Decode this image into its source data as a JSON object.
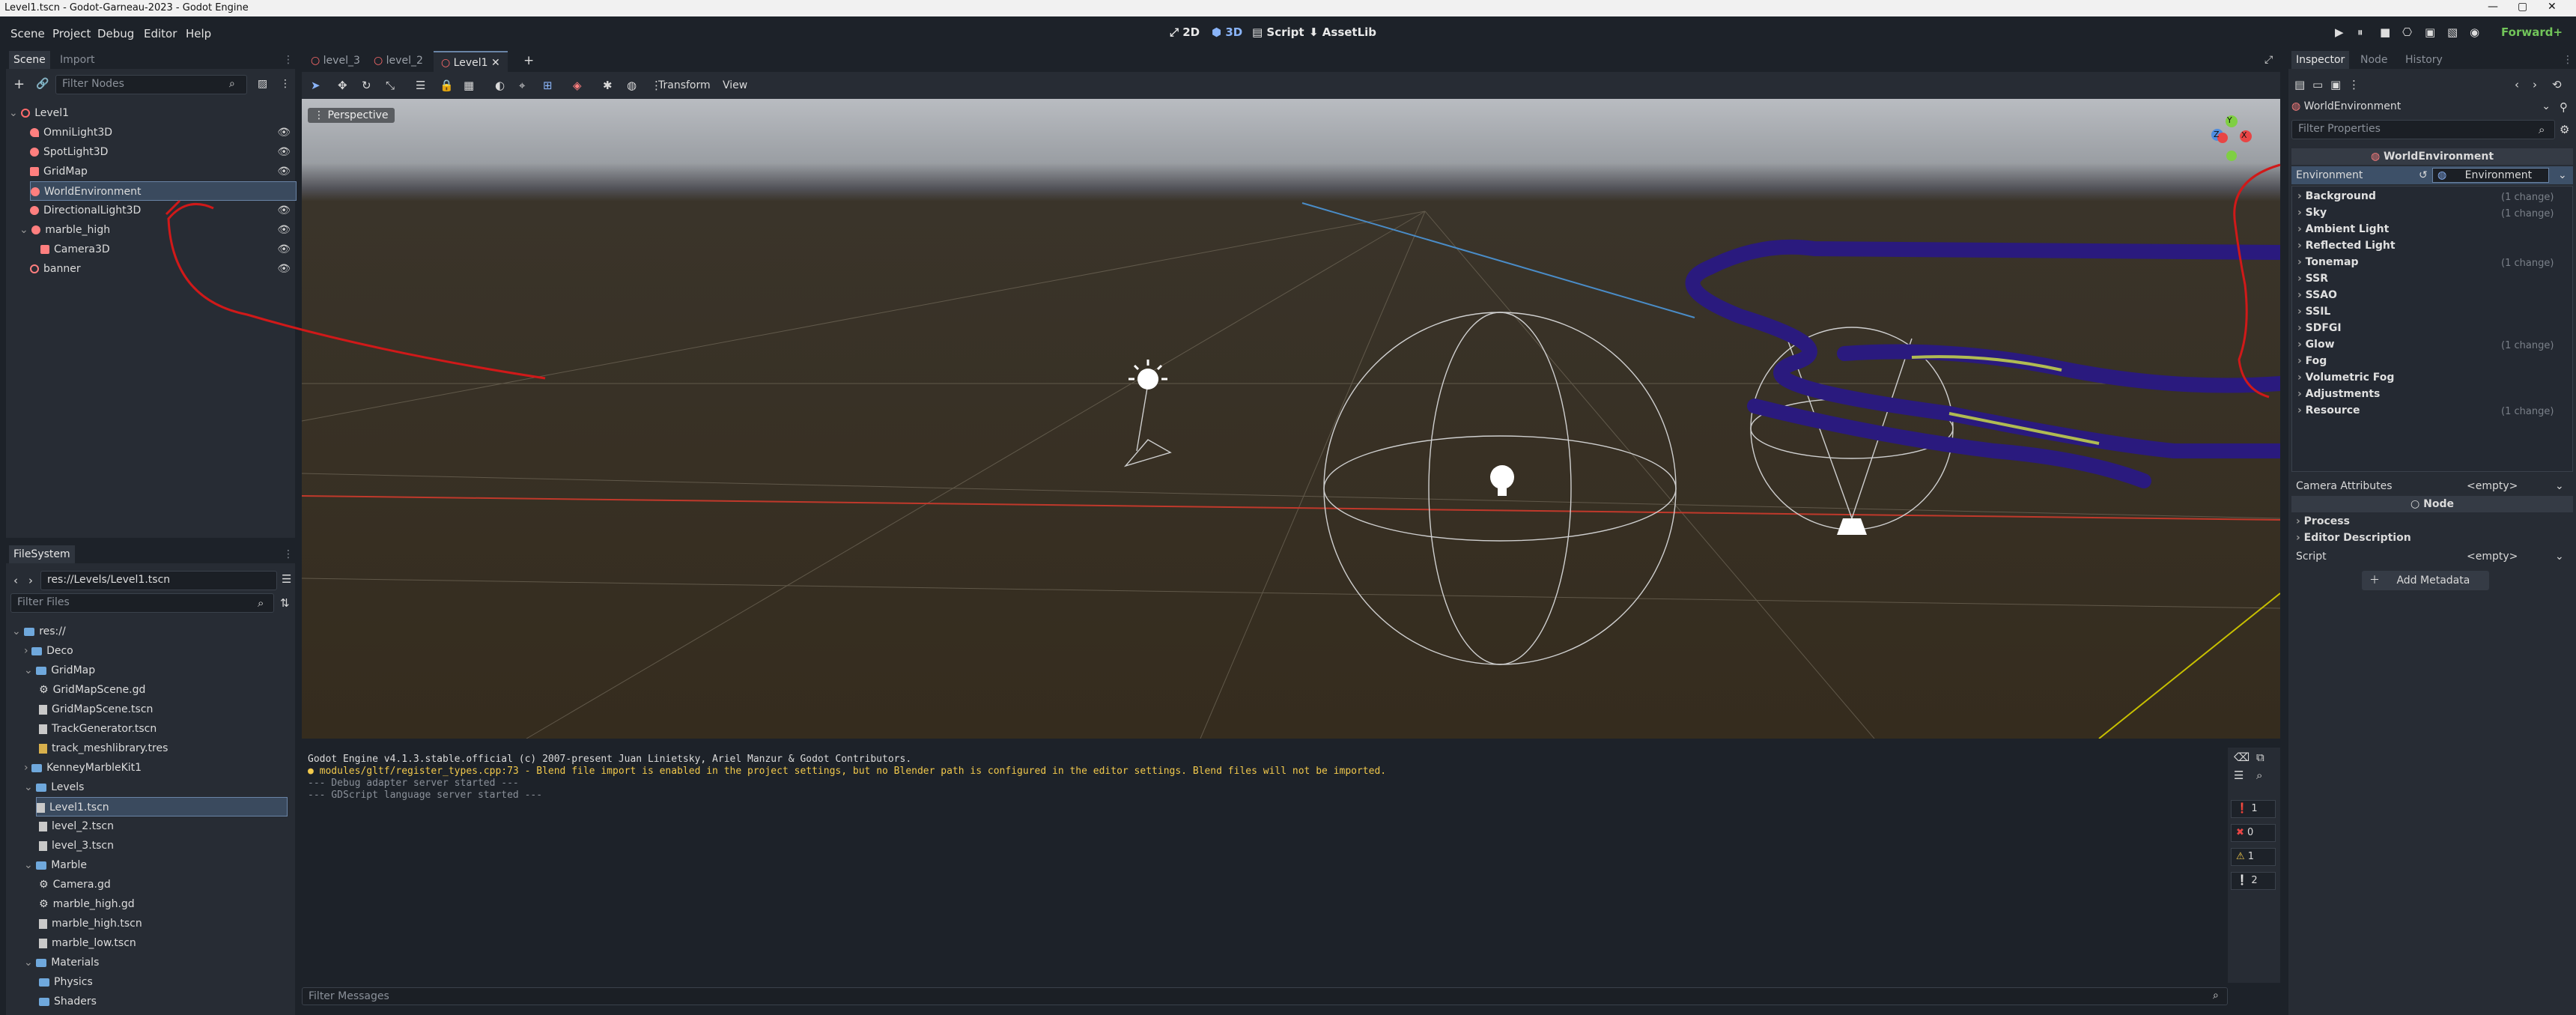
{
  "window": {
    "title": "Level1.tscn - Godot-Garneau-2023 - Godot Engine",
    "controls": [
      "—",
      "▢",
      "✕"
    ]
  },
  "menu": {
    "items": [
      "Scene",
      "Project",
      "Debug",
      "Editor",
      "Help"
    ]
  },
  "workspaces": {
    "items": [
      "2D",
      "3D",
      "Script",
      "AssetLib"
    ]
  },
  "renderer": "Forward+",
  "scene_dock": {
    "tabs": [
      "Scene",
      "Import"
    ],
    "filter_placeholder": "Filter Nodes",
    "nodes": [
      {
        "label": "Level1",
        "color": "#ff6b6b"
      },
      {
        "label": "OmniLight3D",
        "color": "#ff7f7f"
      },
      {
        "label": "SpotLight3D",
        "color": "#ff7f7f"
      },
      {
        "label": "GridMap",
        "color": "#ff7f7f"
      },
      {
        "label": "WorldEnvironment",
        "color": "#ff7f7f"
      },
      {
        "label": "DirectionalLight3D",
        "color": "#ff7f7f"
      },
      {
        "label": "marble_high",
        "color": "#ff7f7f"
      },
      {
        "label": "Camera3D",
        "color": "#ff7f7f"
      },
      {
        "label": "banner",
        "color": "#ff7f7f"
      }
    ]
  },
  "filesystem": {
    "tab": "FileSystem",
    "path": "res://Levels/Level1.tscn",
    "filter_placeholder": "Filter Files",
    "items": [
      "res://",
      "Deco",
      "GridMap",
      "GridMapScene.gd",
      "GridMapScene.tscn",
      "TrackGenerator.tscn",
      "track_meshlibrary.tres",
      "KenneyMarbleKit1",
      "Levels",
      "Level1.tscn",
      "level_2.tscn",
      "level_3.tscn",
      "Marble",
      "Camera.gd",
      "marble_high.gd",
      "marble_high.tscn",
      "marble_low.tscn",
      "Materials",
      "Physics",
      "Shaders"
    ]
  },
  "editor_tabs": {
    "items": [
      "level_3",
      "level_2",
      "Level1"
    ],
    "add": "+"
  },
  "viewport_toolbar": {
    "transform": "Transform",
    "view": "View"
  },
  "viewport": {
    "perspective_label": "Perspective",
    "gizmo_axes": [
      "X",
      "Y",
      "Z"
    ]
  },
  "console": {
    "lines": [
      "Godot Engine v4.1.3.stable.official (c) 2007-present Juan Linietsky, Ariel Manzur & Godot Contributors.",
      "modules/gltf/register_types.cpp:73 - Blend file import is enabled in the project settings, but no Blender path is configured in the editor settings. Blend files will not be imported.",
      "--- Debug adapter server started ---",
      "--- GDScript language server started ---"
    ],
    "counts": [
      "1",
      "0",
      "1",
      "2"
    ],
    "filter_placeholder": "Filter Messages"
  },
  "inspector": {
    "tabs": [
      "Inspector",
      "Node",
      "History"
    ],
    "object": "WorldEnvironment",
    "filter_placeholder": "Filter Properties",
    "class_header": "WorldEnvironment",
    "environment_label": "Environment",
    "environment_value": "Environment",
    "sections": [
      {
        "label": "Background",
        "change": "(1 change)"
      },
      {
        "label": "Sky",
        "change": "(1 change)"
      },
      {
        "label": "Ambient Light",
        "change": ""
      },
      {
        "label": "Reflected Light",
        "change": ""
      },
      {
        "label": "Tonemap",
        "change": "(1 change)"
      },
      {
        "label": "SSR",
        "change": ""
      },
      {
        "label": "SSAO",
        "change": ""
      },
      {
        "label": "SSIL",
        "change": ""
      },
      {
        "label": "SDFGI",
        "change": ""
      },
      {
        "label": "Glow",
        "change": "(1 change)"
      },
      {
        "label": "Fog",
        "change": ""
      },
      {
        "label": "Volumetric Fog",
        "change": ""
      },
      {
        "label": "Adjustments",
        "change": ""
      },
      {
        "label": "Resource",
        "change": "(1 change)"
      }
    ],
    "camera_attributes_label": "Camera Attributes",
    "camera_attributes_value": "<empty>",
    "node_header": "Node",
    "process": "Process",
    "editor_description": "Editor Description",
    "script_label": "Script",
    "script_value": "<empty>",
    "add_metadata": "Add Metadata"
  },
  "colors": {
    "accent": "#6a84a6",
    "annotation": "#d01919",
    "track_purple": "#3a1f8c",
    "track_yellow": "#c8d84a"
  }
}
